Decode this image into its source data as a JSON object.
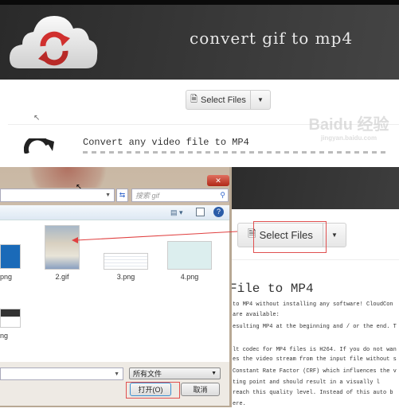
{
  "top_panel": {
    "title": "convert gif to mp4",
    "select_files_label": "Select Files",
    "section_heading": "Convert any video file to MP4"
  },
  "bottom_panel": {
    "select_files_label": "Select Files",
    "heading": "File to MP4",
    "body_lines": [
      "to MP4 without installing any software! CloudCon",
      "are available:",
      "esulting MP4 at the beginning and / or the end. T",
      "lt codec for MP4 files is H264. If you do not wan",
      "es the video stream from the input file without s",
      "Constant Rate Factor (CRF) which influences the v",
      "ting point and should result in a visually l",
      " reach this quality level. Instead of this auto b",
      "ere."
    ]
  },
  "dialog": {
    "search_placeholder": "搜索 gif",
    "files": [
      {
        "name": "png"
      },
      {
        "name": "2.gif"
      },
      {
        "name": "3.png"
      },
      {
        "name": "4.png"
      },
      {
        "name": "ng"
      }
    ],
    "file_type": "所有文件",
    "open_label": "打开(O)",
    "cancel_label": "取消",
    "close_label": "✕"
  },
  "watermark": {
    "brand": "Baidu 经验",
    "url": "jingyan.baidu.com"
  },
  "colors": {
    "header_dark": "#333333",
    "logo_red": "#d0302e",
    "highlight_red": "#e05050"
  }
}
